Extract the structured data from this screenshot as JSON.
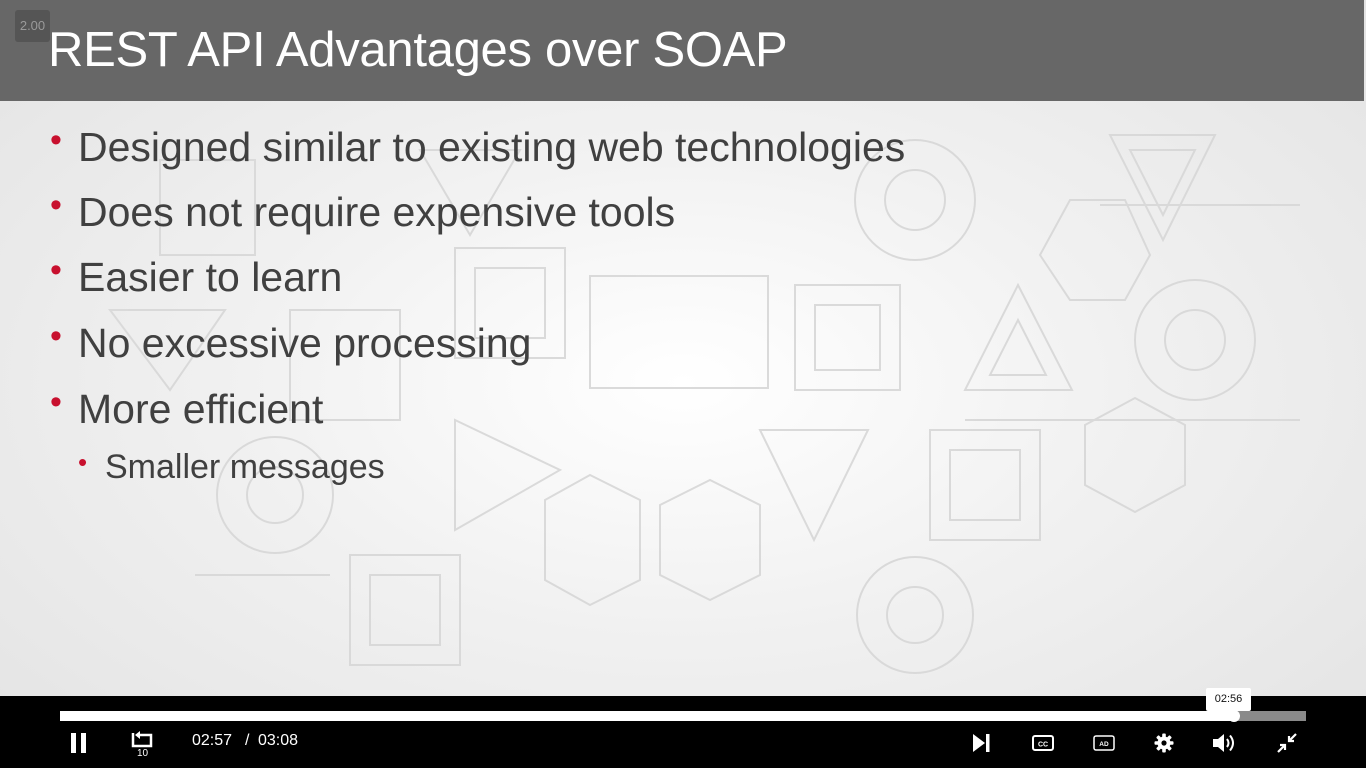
{
  "slide": {
    "title": "REST API Advantages over SOAP",
    "bullets": [
      "Designed similar to existing web technologies",
      "Does not require expensive tools",
      "Easier to learn",
      "No excessive processing",
      "More efficient"
    ],
    "sub_bullets": [
      "Smaller messages"
    ],
    "bullet_color": "#c8102e"
  },
  "player": {
    "playback_speed": "2.00",
    "current_time": "02:57",
    "separator": "/",
    "duration": "03:08",
    "hover_time": "02:56",
    "progress_fraction": 0.942,
    "controls": {
      "play_pause": "pause-icon",
      "rewind": "rewind-10-icon",
      "rewind_label": "10",
      "next": "skip-next-icon",
      "captions": "closed-captions-icon",
      "captions_label": "CC",
      "audio_description": "audio-description-icon",
      "audio_description_label": "AD",
      "settings": "gear-icon",
      "volume": "volume-icon",
      "fullscreen_exit": "exit-fullscreen-icon"
    }
  }
}
